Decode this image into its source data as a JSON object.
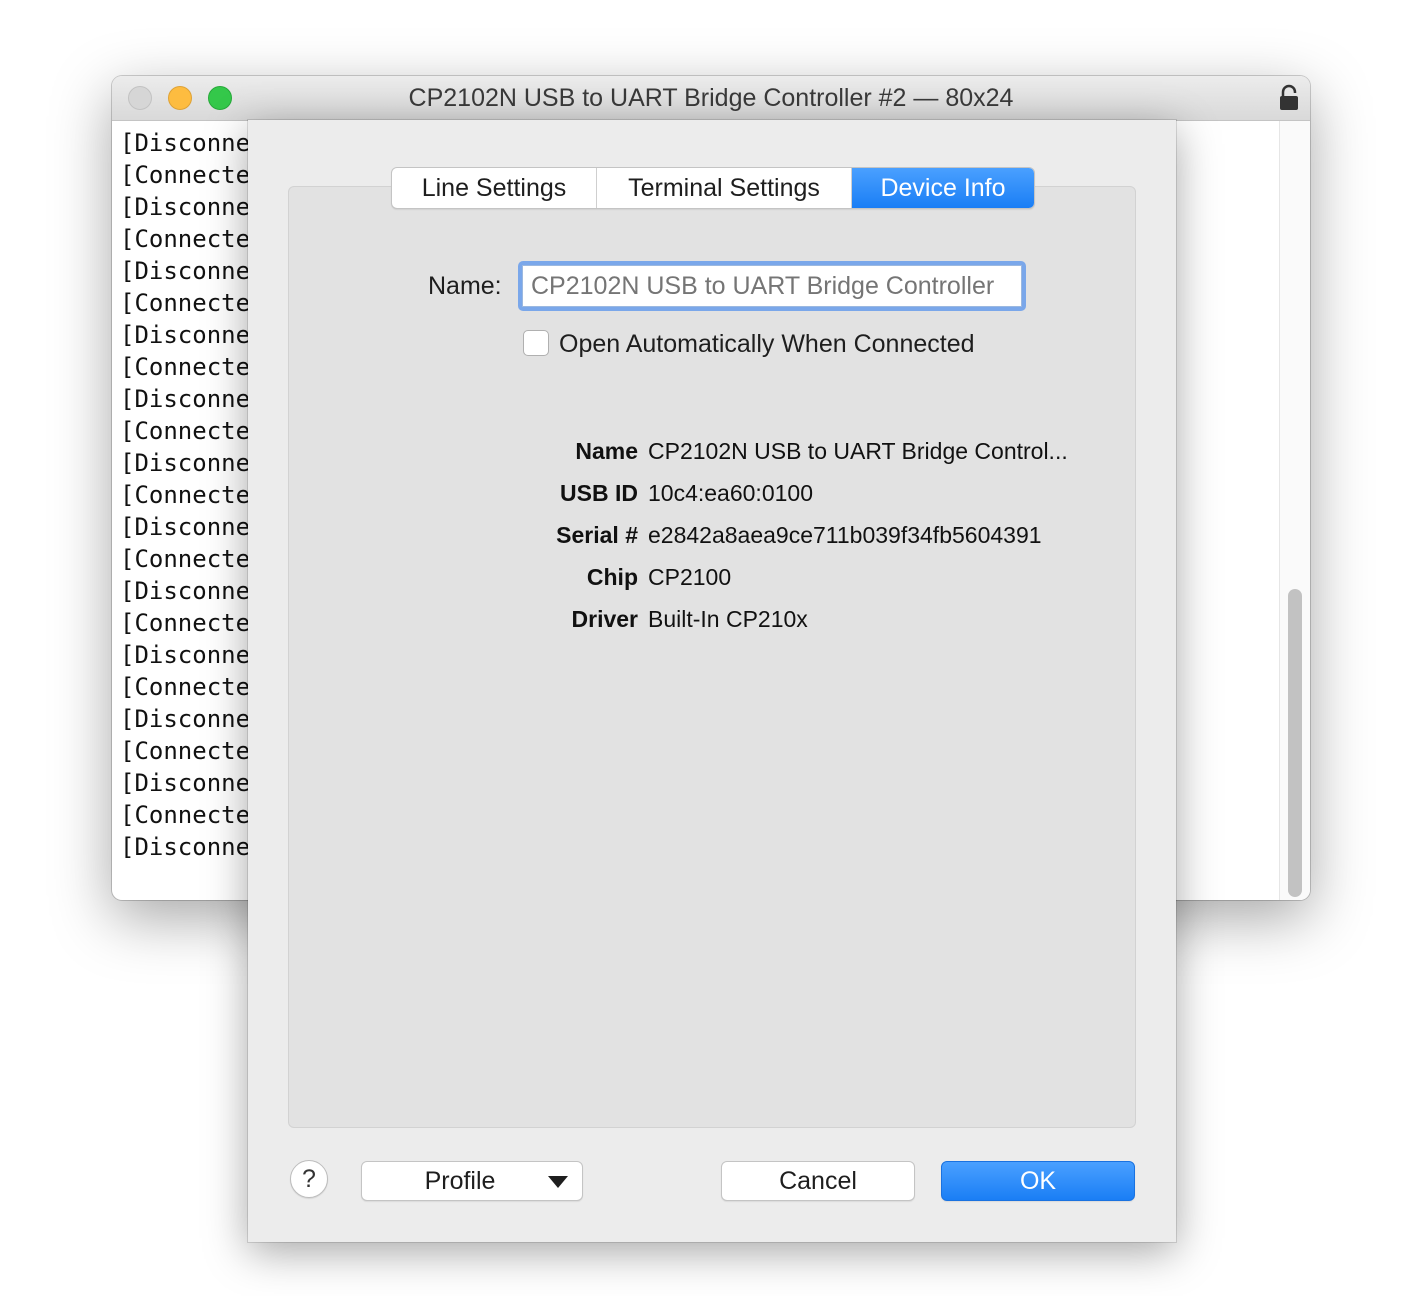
{
  "window": {
    "title": "CP2102N USB to UART Bridge Controller #2 — 80x24"
  },
  "terminal": {
    "lines": [
      "[Disconne",
      "[Connecte",
      "[Disconne",
      "[Connecte",
      "[Disconne",
      "[Connecte",
      "[Disconne",
      "[Connecte",
      "[Disconne",
      "[Connecte",
      "[Disconne",
      "[Connecte",
      "[Disconne",
      "[Connecte",
      "[Disconne",
      "[Connecte",
      "[Disconne",
      "[Connecte",
      "[Disconne",
      "[Connecte",
      "[Disconne",
      "[Connecte",
      "[Disconne"
    ]
  },
  "tabs": [
    {
      "label": "Line Settings",
      "active": false
    },
    {
      "label": "Terminal Settings",
      "active": false
    },
    {
      "label": "Device Info",
      "active": true
    }
  ],
  "form": {
    "name_label": "Name:",
    "name_placeholder": "CP2102N USB to UART Bridge Controller",
    "open_auto_label": "Open Automatically When Connected",
    "open_auto_checked": false
  },
  "info": [
    {
      "key": "Name",
      "value": "CP2102N USB to UART Bridge Control..."
    },
    {
      "key": "USB ID",
      "value": "10c4:ea60:0100"
    },
    {
      "key": "Serial #",
      "value": "e2842a8aea9ce711b039f34fb5604391"
    },
    {
      "key": "Chip",
      "value": "CP2100"
    },
    {
      "key": "Driver",
      "value": "Built-In CP210x"
    }
  ],
  "buttons": {
    "help": "?",
    "profile": "Profile",
    "cancel": "Cancel",
    "ok": "OK"
  },
  "colors": {
    "accent": "#1a7ef5",
    "close": "#d6d6d6",
    "minimize": "#fdbc40",
    "maximize": "#34c84a"
  }
}
